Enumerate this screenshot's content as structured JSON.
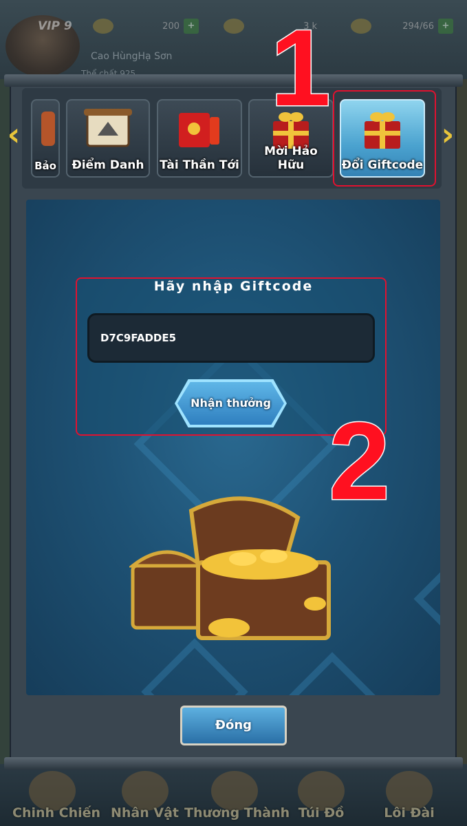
{
  "hud": {
    "vip": "VIP 9",
    "player_name": "Cao HùngHạ Sơn",
    "player_sub": "Thể chất 925",
    "resources": [
      {
        "icon": "gold-ingot-icon",
        "value": "200"
      },
      {
        "icon": "coin-icon",
        "value": "3 k"
      },
      {
        "icon": "rice-icon",
        "value": "294/66"
      }
    ]
  },
  "tabs": [
    {
      "label": "Bảo",
      "icon": "scroll-icon"
    },
    {
      "label": "Điểm Danh",
      "icon": "checkin-scroll-icon"
    },
    {
      "label": "Tài Thần Tới",
      "icon": "red-envelope-icon"
    },
    {
      "label": "Mời Hảo Hữu",
      "icon": "gift-box-icon"
    },
    {
      "label": "Đổi Giftcode",
      "icon": "gift-box-icon"
    }
  ],
  "active_tab": "Đổi Giftcode",
  "giftcode": {
    "title": "Hãy nhập Giftcode",
    "code_value": "D7C9FADDE5",
    "claim_label": "Nhận thưởng"
  },
  "close_label": "Đóng",
  "annotations": {
    "step1": "1",
    "step2": "2"
  },
  "bottom_nav": [
    "Chinh Chiến",
    "Nhân Vật",
    "Thương Thành",
    "Túi Đồ",
    "Lôi Đài"
  ],
  "colors": {
    "highlight": "#e2112f",
    "accent": "#4aa2cf",
    "arrow": "#e7c43b"
  }
}
